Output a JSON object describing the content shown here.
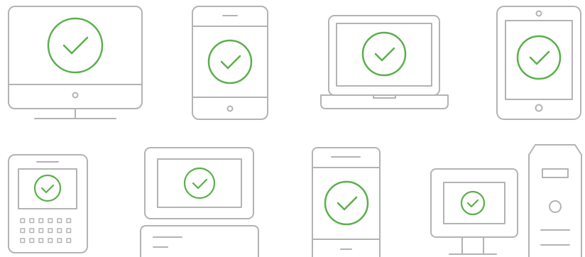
{
  "colors": {
    "outline": "#b3b3b3",
    "check": "#5ab04b",
    "background": "#ffffff"
  },
  "devices": [
    {
      "name": "desktop-monitor",
      "icon": "desktop-monitor-icon",
      "status": "check-icon"
    },
    {
      "name": "smartphone",
      "icon": "smartphone-icon",
      "status": "check-icon"
    },
    {
      "name": "laptop",
      "icon": "laptop-icon",
      "status": "check-icon"
    },
    {
      "name": "tablet",
      "icon": "tablet-icon",
      "status": "check-icon"
    },
    {
      "name": "keypad-phone",
      "icon": "keypad-phone-icon",
      "status": "check-icon"
    },
    {
      "name": "game-console-handheld",
      "icon": "dual-screen-device-icon",
      "status": "check-icon"
    },
    {
      "name": "tall-smartphone",
      "icon": "tall-smartphone-icon",
      "status": "check-icon"
    },
    {
      "name": "pc-tower-with-monitor",
      "icon": "pc-tower-icon",
      "status": "check-icon"
    }
  ]
}
